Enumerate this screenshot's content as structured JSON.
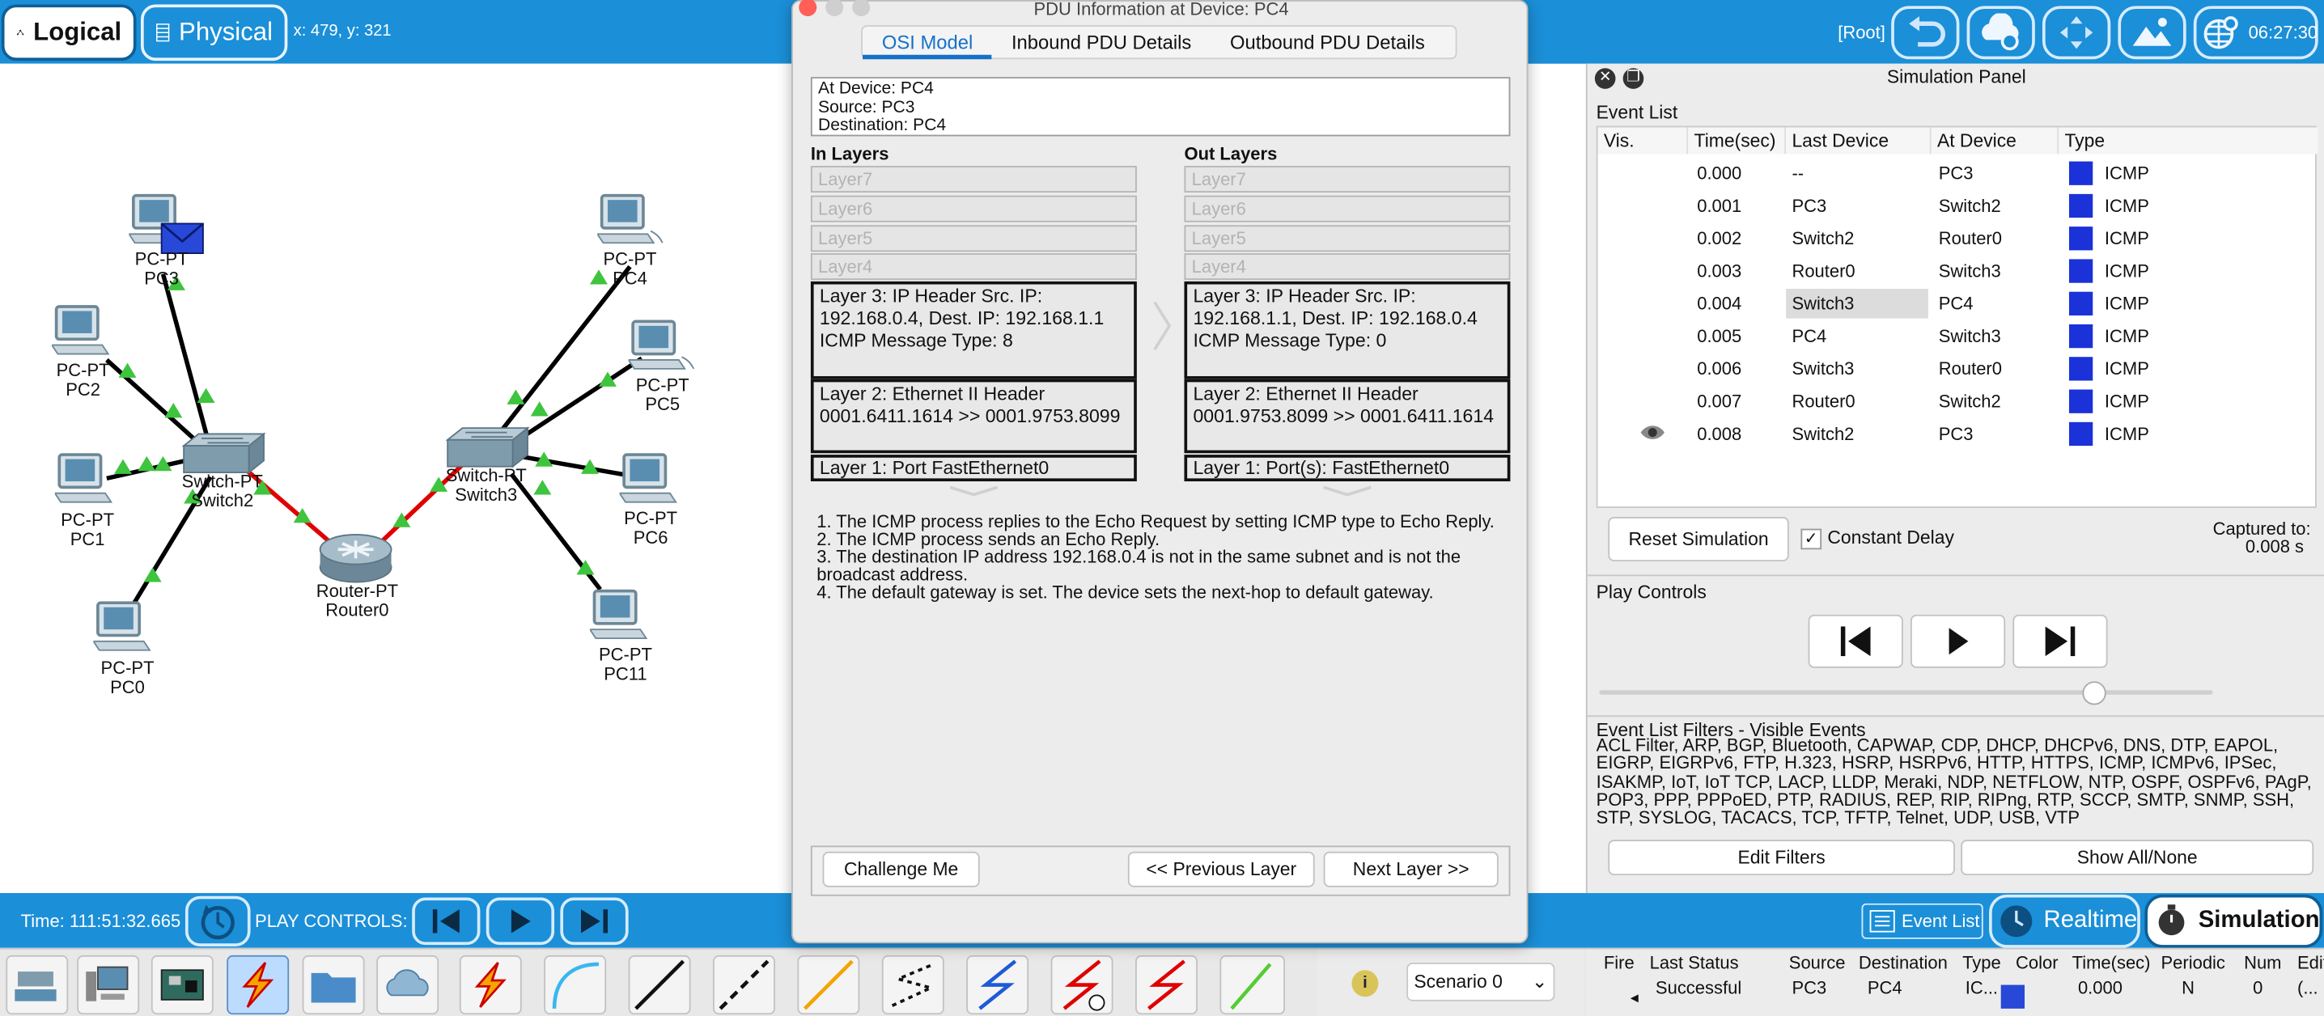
{
  "topbar": {
    "logical_label": "Logical",
    "physical_label": "Physical",
    "coords": "x: 479, y: 321",
    "root_label": "[Root]",
    "clock": "06:27:30"
  },
  "topology": {
    "devices": [
      {
        "type": "PC-PT",
        "name": "PC3"
      },
      {
        "type": "PC-PT",
        "name": "PC2"
      },
      {
        "type": "PC-PT",
        "name": "PC1"
      },
      {
        "type": "PC-PT",
        "name": "PC0"
      },
      {
        "type": "Switch-PT",
        "name": "Switch2"
      },
      {
        "type": "Router-PT",
        "name": "Router0"
      },
      {
        "type": "Switch-PT",
        "name": "Switch3"
      },
      {
        "type": "PC-PT",
        "name": "PC4"
      },
      {
        "type": "PC-PT",
        "name": "PC5"
      },
      {
        "type": "PC-PT",
        "name": "PC6"
      },
      {
        "type": "PC-PT",
        "name": "PC11"
      }
    ]
  },
  "pdu": {
    "window_title": "PDU Information at Device: PC4",
    "tabs": [
      "OSI Model",
      "Inbound PDU Details",
      "Outbound PDU Details"
    ],
    "at_device": "At Device: PC4",
    "source": "Source: PC3",
    "destination": "Destination: PC4",
    "in_layers_title": "In Layers",
    "out_layers_title": "Out Layers",
    "in_layers": {
      "l7": "Layer7",
      "l6": "Layer6",
      "l5": "Layer5",
      "l4": "Layer4",
      "l3": "Layer 3: IP Header Src. IP: 192.168.0.4, Dest. IP: 192.168.1.1 ICMP Message Type: 8",
      "l2": "Layer 2: Ethernet II Header 0001.6411.1614 >> 0001.9753.8099",
      "l1": "Layer 1: Port FastEthernet0"
    },
    "out_layers": {
      "l7": "Layer7",
      "l6": "Layer6",
      "l5": "Layer5",
      "l4": "Layer4",
      "l3": "Layer 3: IP Header Src. IP: 192.168.1.1, Dest. IP: 192.168.0.4 ICMP Message Type: 0",
      "l2": "Layer 2: Ethernet II Header 0001.9753.8099 >> 0001.6411.1614",
      "l1": "Layer 1: Port(s): FastEthernet0"
    },
    "steps": [
      "1. The ICMP process replies to the Echo Request by setting ICMP type to Echo Reply.",
      "2. The ICMP process sends an Echo Reply.",
      "3. The destination IP address 192.168.0.4 is not in the same subnet and is not the broadcast address.",
      "4. The default gateway is set. The device sets the next-hop to default gateway."
    ],
    "challenge_label": "Challenge Me",
    "prev_label": "<< Previous Layer",
    "next_label": "Next Layer >>"
  },
  "sim_panel": {
    "title": "Simulation Panel",
    "event_list_title": "Event List",
    "headers": [
      "Vis.",
      "Time(sec)",
      "Last Device",
      "At Device",
      "Type"
    ],
    "events": [
      {
        "time": "0.000",
        "last": "--",
        "at": "PC3",
        "type": "ICMP"
      },
      {
        "time": "0.001",
        "last": "PC3",
        "at": "Switch2",
        "type": "ICMP"
      },
      {
        "time": "0.002",
        "last": "Switch2",
        "at": "Router0",
        "type": "ICMP"
      },
      {
        "time": "0.003",
        "last": "Router0",
        "at": "Switch3",
        "type": "ICMP"
      },
      {
        "time": "0.004",
        "last": "Switch3",
        "at": "PC4",
        "type": "ICMP"
      },
      {
        "time": "0.005",
        "last": "PC4",
        "at": "Switch3",
        "type": "ICMP"
      },
      {
        "time": "0.006",
        "last": "Switch3",
        "at": "Router0",
        "type": "ICMP"
      },
      {
        "time": "0.007",
        "last": "Router0",
        "at": "Switch2",
        "type": "ICMP"
      },
      {
        "time": "0.008",
        "last": "Switch2",
        "at": "PC3",
        "type": "ICMP"
      }
    ],
    "type_color": "#1a32d8",
    "reset_label": "Reset Simulation",
    "constant_delay_label": "Constant Delay",
    "captured_label": "Captured to:",
    "captured_value": "0.008 s",
    "play_controls_title": "Play Controls",
    "filters_title": "Event List Filters - Visible Events",
    "filters_text": "ACL Filter, ARP, BGP, Bluetooth, CAPWAP, CDP, DHCP, DHCPv6, DNS, DTP, EAPOL, EIGRP, EIGRPv6, FTP, H.323, HSRP, HSRPv6, HTTP, HTTPS, ICMP, ICMPv6, IPSec, ISAKMP, IoT, IoT TCP, LACP, LLDP, Meraki, NDP, NETFLOW, NTP, OSPF, OSPFv6, PAgP, POP3, PPP, PPPoED, PTP, RADIUS, REP, RIP, RIPng, RTP, SCCP, SMTP, SNMP, SSH, STP, SYSLOG, TACACS, TCP, TFTP, Telnet, UDP, USB, VTP",
    "edit_filters_label": "Edit Filters",
    "show_all_label": "Show All/None"
  },
  "bottombar": {
    "time": "Time: 111:51:32.665",
    "play_controls": "PLAY CONTROLS:",
    "event_list_label": "Event List",
    "realtime_label": "Realtime",
    "simulation_label": "Simulation"
  },
  "scenario": {
    "label": "Scenario 0"
  },
  "pdu_list": {
    "headers": [
      "Fire",
      "Last Status",
      "Source",
      "Destination",
      "Type",
      "Color",
      "Time(sec)",
      "Periodic",
      "Num",
      "Edit"
    ],
    "row": {
      "status": "Successful",
      "source": "PC3",
      "destination": "PC4",
      "type": "IC...",
      "time": "0.000",
      "periodic": "N",
      "num": "0",
      "edit": "(..."
    }
  }
}
